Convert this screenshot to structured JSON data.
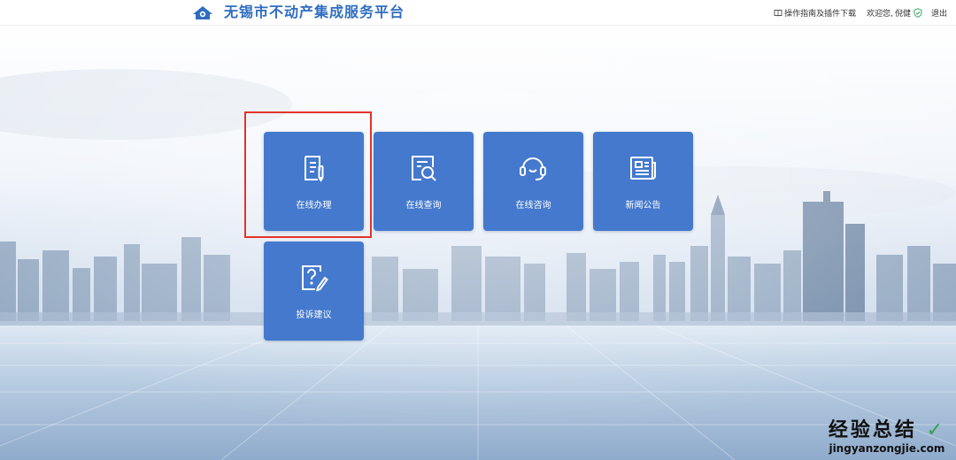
{
  "header": {
    "title": "无锡市不动产集成服务平台",
    "guide_link": "操作指南及插件下载",
    "welcome": "欢迎您,",
    "username": "倪健",
    "logout": "退出"
  },
  "tiles": [
    {
      "label": "在线办理",
      "icon": "document-pen-icon"
    },
    {
      "label": "在线查询",
      "icon": "search-document-icon"
    },
    {
      "label": "在线咨询",
      "icon": "headset-icon"
    },
    {
      "label": "新闻公告",
      "icon": "newspaper-icon"
    },
    {
      "label": "投诉建议",
      "icon": "question-pen-icon"
    }
  ],
  "watermark": {
    "text": "经验总结",
    "url": "jingyanzongjie.com"
  },
  "colors": {
    "brand": "#2f6dc0",
    "tile": "#4479cd",
    "highlight": "#e4332a"
  }
}
